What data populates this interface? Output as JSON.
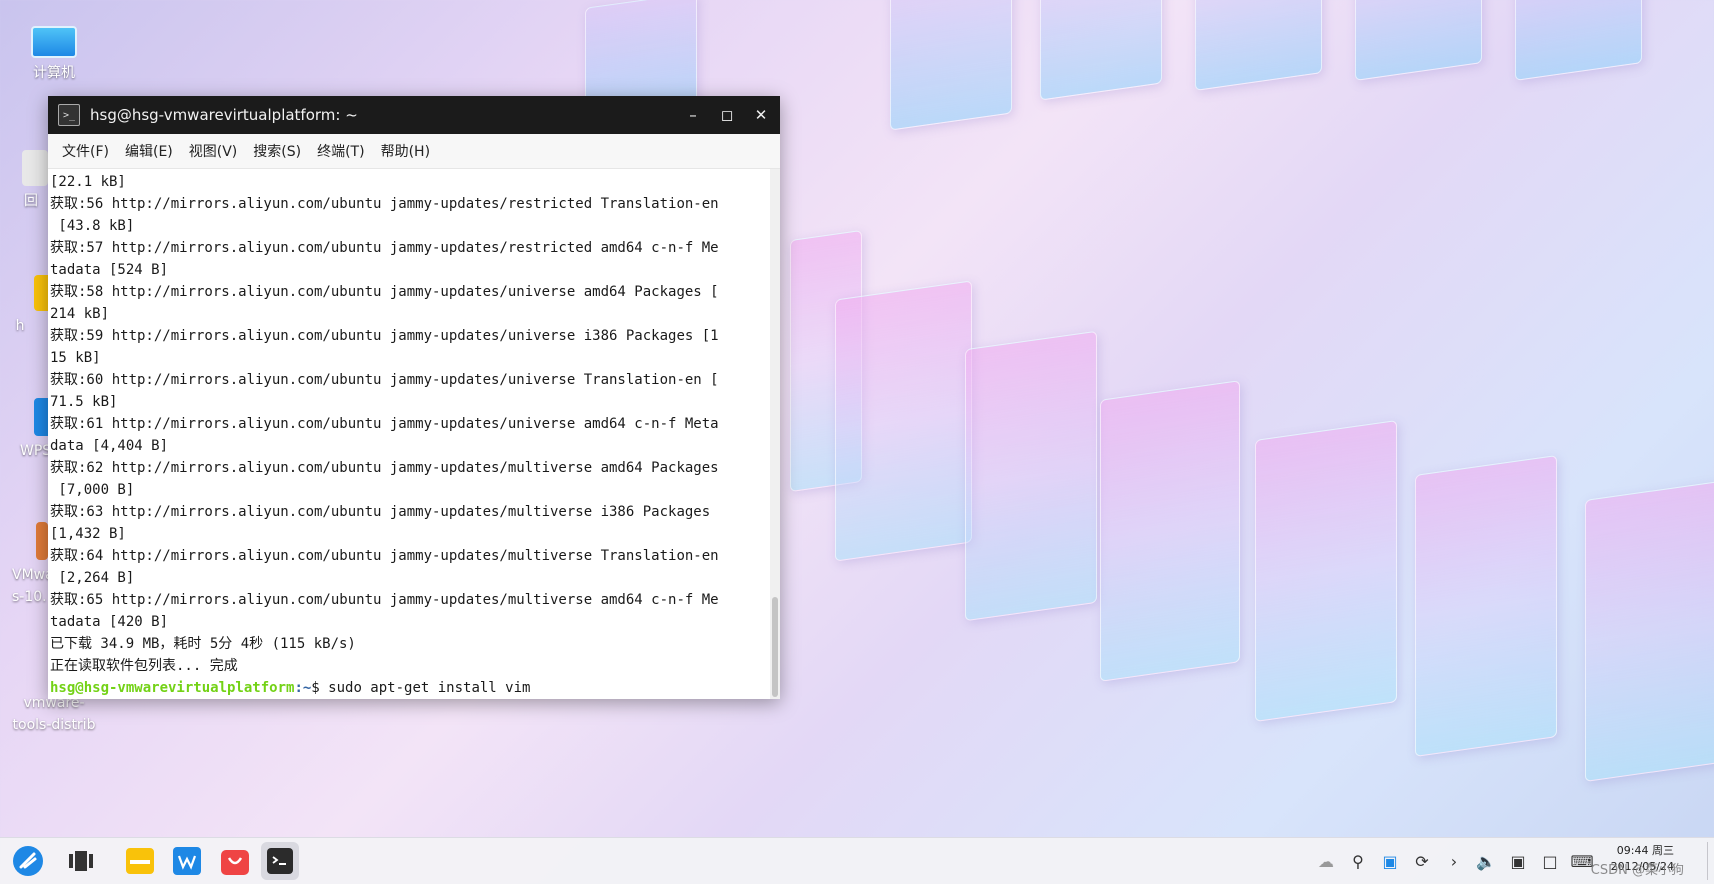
{
  "desktop": {
    "icons": [
      {
        "label": "计算机",
        "icon": "computer-icon"
      },
      {
        "label": "回",
        "icon": "trash-icon"
      },
      {
        "label": "h",
        "icon": "folder-icon"
      },
      {
        "label": "WPS",
        "icon": "wps-icon"
      },
      {
        "label": "VMwa\ns-10.",
        "icon": "archive-icon"
      },
      {
        "label": "vmware-\ntools-distrib",
        "icon": "folder-icon"
      }
    ]
  },
  "terminal": {
    "title": "hsg@hsg-vmwarevirtualplatform: ~",
    "menu": [
      "文件(F)",
      "编辑(E)",
      "视图(V)",
      "搜索(S)",
      "终端(T)",
      "帮助(H)"
    ],
    "lines": [
      "[22.1 kB]",
      "获取:56 http://mirrors.aliyun.com/ubuntu jammy-updates/restricted Translation-en",
      " [43.8 kB]",
      "获取:57 http://mirrors.aliyun.com/ubuntu jammy-updates/restricted amd64 c-n-f Me",
      "tadata [524 B]",
      "获取:58 http://mirrors.aliyun.com/ubuntu jammy-updates/universe amd64 Packages [",
      "214 kB]",
      "获取:59 http://mirrors.aliyun.com/ubuntu jammy-updates/universe i386 Packages [1",
      "15 kB]",
      "获取:60 http://mirrors.aliyun.com/ubuntu jammy-updates/universe Translation-en [",
      "71.5 kB]",
      "获取:61 http://mirrors.aliyun.com/ubuntu jammy-updates/universe amd64 c-n-f Meta",
      "data [4,404 B]",
      "获取:62 http://mirrors.aliyun.com/ubuntu jammy-updates/multiverse amd64 Packages",
      " [7,000 B]",
      "获取:63 http://mirrors.aliyun.com/ubuntu jammy-updates/multiverse i386 Packages",
      "[1,432 B]",
      "获取:64 http://mirrors.aliyun.com/ubuntu jammy-updates/multiverse Translation-en",
      " [2,264 B]",
      "获取:65 http://mirrors.aliyun.com/ubuntu jammy-updates/multiverse amd64 c-n-f Me",
      "tadata [420 B]",
      "已下载 34.9 MB，耗时 5分 4秒 (115 kB/s)",
      "正在读取软件包列表... 完成"
    ],
    "prompt": {
      "user_host": "hsg@hsg-vmwarevirtualplatform",
      "path": ":~",
      "symbol": "$ ",
      "command": "sudo apt-get install vim"
    }
  },
  "taskbar": {
    "apps": [
      {
        "name": "start-menu",
        "icon": "kylin-logo-icon"
      },
      {
        "name": "multitask-view",
        "icon": "multitask-icon"
      },
      {
        "name": "file-manager",
        "icon": "folder-icon"
      },
      {
        "name": "wps",
        "icon": "wps-icon"
      },
      {
        "name": "software-store",
        "icon": "store-icon"
      },
      {
        "name": "terminal",
        "icon": "terminal-icon",
        "active": true
      }
    ],
    "clock": {
      "time": "09:44 周三",
      "date": "2012/05/24"
    },
    "watermark": "CSDN @菜小狗"
  },
  "colors": {
    "prompt_user": "#73d216",
    "titlebar": "#1b1b1b",
    "brand": "#1e88e5"
  }
}
